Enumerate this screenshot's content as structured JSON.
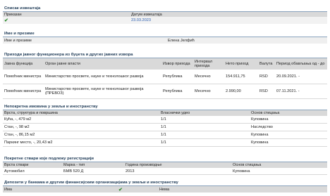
{
  "reports": {
    "title": "Списак извештаја",
    "col_submitted": "Приказан",
    "col_date": "Датум извештаја",
    "date_value": "23.03.2023",
    "check_icon": "checkmark-icon"
  },
  "name_section": {
    "title": "Име и презиме",
    "label": "Име и презиме",
    "value": "Елена Јелфић"
  },
  "income": {
    "title": "Приходи јавног функционера из буџета и других јавних извора",
    "headers": [
      "Јавна функција",
      "Орган јавне власти",
      "Извор прихода",
      "Интервал прихода",
      "Нето приход",
      "Валута",
      "Период обављања од - до"
    ],
    "rows": [
      [
        "Помоћник министра",
        "Министарство просвете, науке и технолошког развоја",
        "Република",
        "Месечно",
        "154.911,75",
        "RSD",
        "20.09.2021. -"
      ],
      [
        "Помоћник министра",
        "Министарство просвете, науке и технолошког развоја (ПРЕВОЗ)",
        "Република",
        "Месечно",
        "2.990,00",
        "RSD",
        "07.11.2021. -"
      ]
    ]
  },
  "property": {
    "title": "Непокретна имовина у земљи и иностранству",
    "headers": [
      "Врста, структура и површина",
      "Власнички удео",
      "Основ стицања"
    ],
    "rows": [
      [
        "Кућа, -, 479 м2",
        "1/1",
        "Куповина"
      ],
      [
        "Стан, -, 98 м2",
        "1/1",
        "Наследство"
      ],
      [
        "Стан, -, 86,15 м2",
        "1/1",
        "Куповина"
      ],
      [
        "Паркинг место, -, 20,43 м2",
        "1/1",
        "Куповина"
      ]
    ]
  },
  "vehicles": {
    "title": "Покретне ствари које подлежу регистрацији",
    "headers": [
      "Врста ствари",
      "Марка - тип",
      "Година производње",
      "Основ стицања"
    ],
    "rows": [
      [
        "Аутомобил",
        "БМВ 520 Д",
        "2013",
        "Куповина"
      ]
    ]
  },
  "deposits": {
    "title": "Депозити у банкама и другим финансијским организацијама у земљи и иностранству",
    "col_has": "Има",
    "col_none": "Нема",
    "check_icon": "checkmark-icon"
  }
}
